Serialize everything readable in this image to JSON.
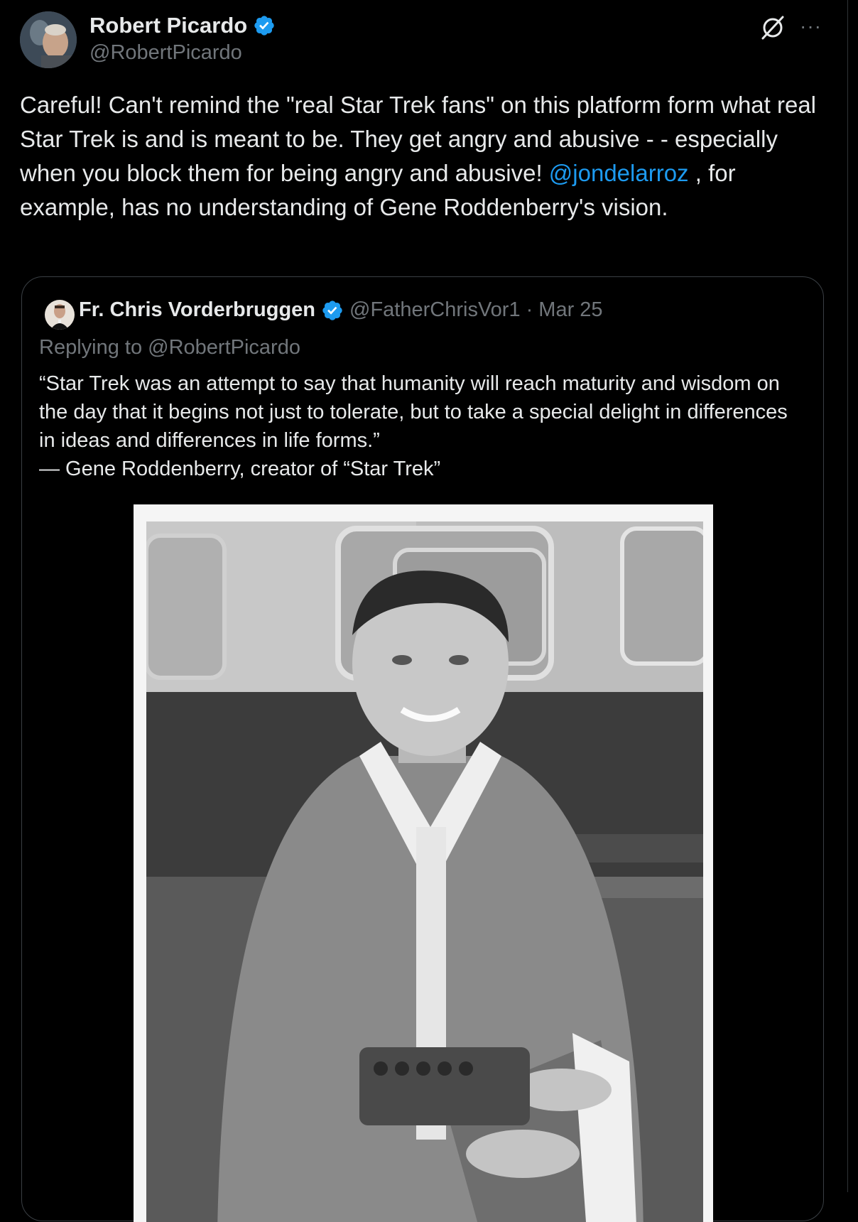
{
  "tweet": {
    "author_name": "Robert Picardo",
    "author_handle": "@RobertPicardo",
    "text_before_mention": "Careful! Can't remind the \"real Star Trek fans\" on this platform form what real Star Trek is and is meant to be. They get angry and abusive - - especially when you block them for being angry and abusive! ",
    "mention": "@jondelarroz",
    "text_after_mention": " , for example, has no understanding of Gene Roddenberry's vision.",
    "more_label": "···"
  },
  "quoted": {
    "author_name": "Fr. Chris Vorderbruggen",
    "author_handle": "@FatherChrisVor1",
    "separator": "·",
    "date": "Mar 25",
    "replying_to": "Replying to @RobertPicardo",
    "text": "“Star Trek was an attempt to say that humanity will reach maturity and wisdom on the day that it begins not just to tolerate, but to take a special delight in differences in ideas and differences in life forms.”\n— Gene Roddenberry, creator of “Star Trek”"
  },
  "icons": {
    "verified": "verified-badge-icon",
    "grok": "grok-icon",
    "more": "more-icon"
  },
  "colors": {
    "background": "#000000",
    "text": "#e7e9ea",
    "secondary": "#71767b",
    "link": "#1d9bf0",
    "border": "#3a3f44"
  }
}
